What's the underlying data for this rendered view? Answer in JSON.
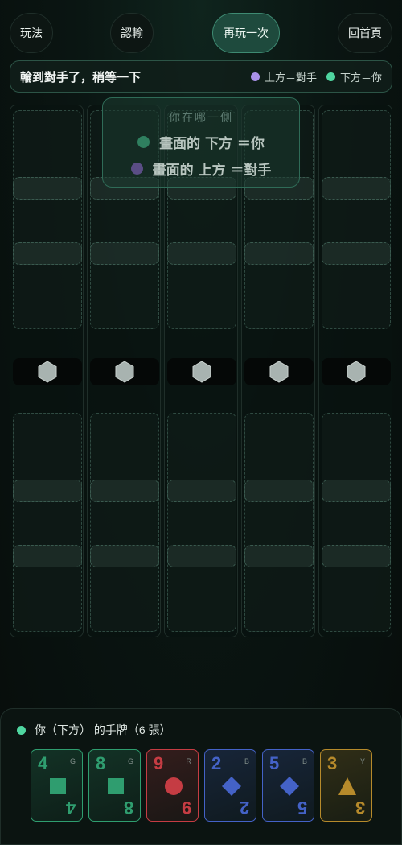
{
  "nav": {
    "rules": "玩法",
    "resign": "認輸",
    "replay": "再玩一次",
    "home": "回首頁"
  },
  "status": {
    "message": "輪到對手了，稍等一下",
    "legend_top": "上方＝對手",
    "legend_bottom": "下方＝你"
  },
  "overlay": {
    "title": "你在哪一側",
    "line1": "畫面的 下方 ＝你",
    "line2": "畫面的 上方 ＝對手"
  },
  "board": {
    "columns": 5
  },
  "hand": {
    "title": "你（下方）  的手牌（6 張）",
    "cards": [
      {
        "value": "4",
        "code": "G",
        "shape": "square",
        "color": "#2f9d6f"
      },
      {
        "value": "8",
        "code": "G",
        "shape": "square",
        "color": "#2f9d6f"
      },
      {
        "value": "9",
        "code": "R",
        "shape": "circle",
        "color": "#c53c43"
      },
      {
        "value": "2",
        "code": "B",
        "shape": "diamond",
        "color": "#4462c7"
      },
      {
        "value": "5",
        "code": "B",
        "shape": "diamond",
        "color": "#4462c7"
      },
      {
        "value": "3",
        "code": "Y",
        "shape": "triangle",
        "color": "#b68a2b"
      }
    ]
  },
  "colors": {
    "accent": "#4fd6a0",
    "opponent": "#a991e8"
  }
}
